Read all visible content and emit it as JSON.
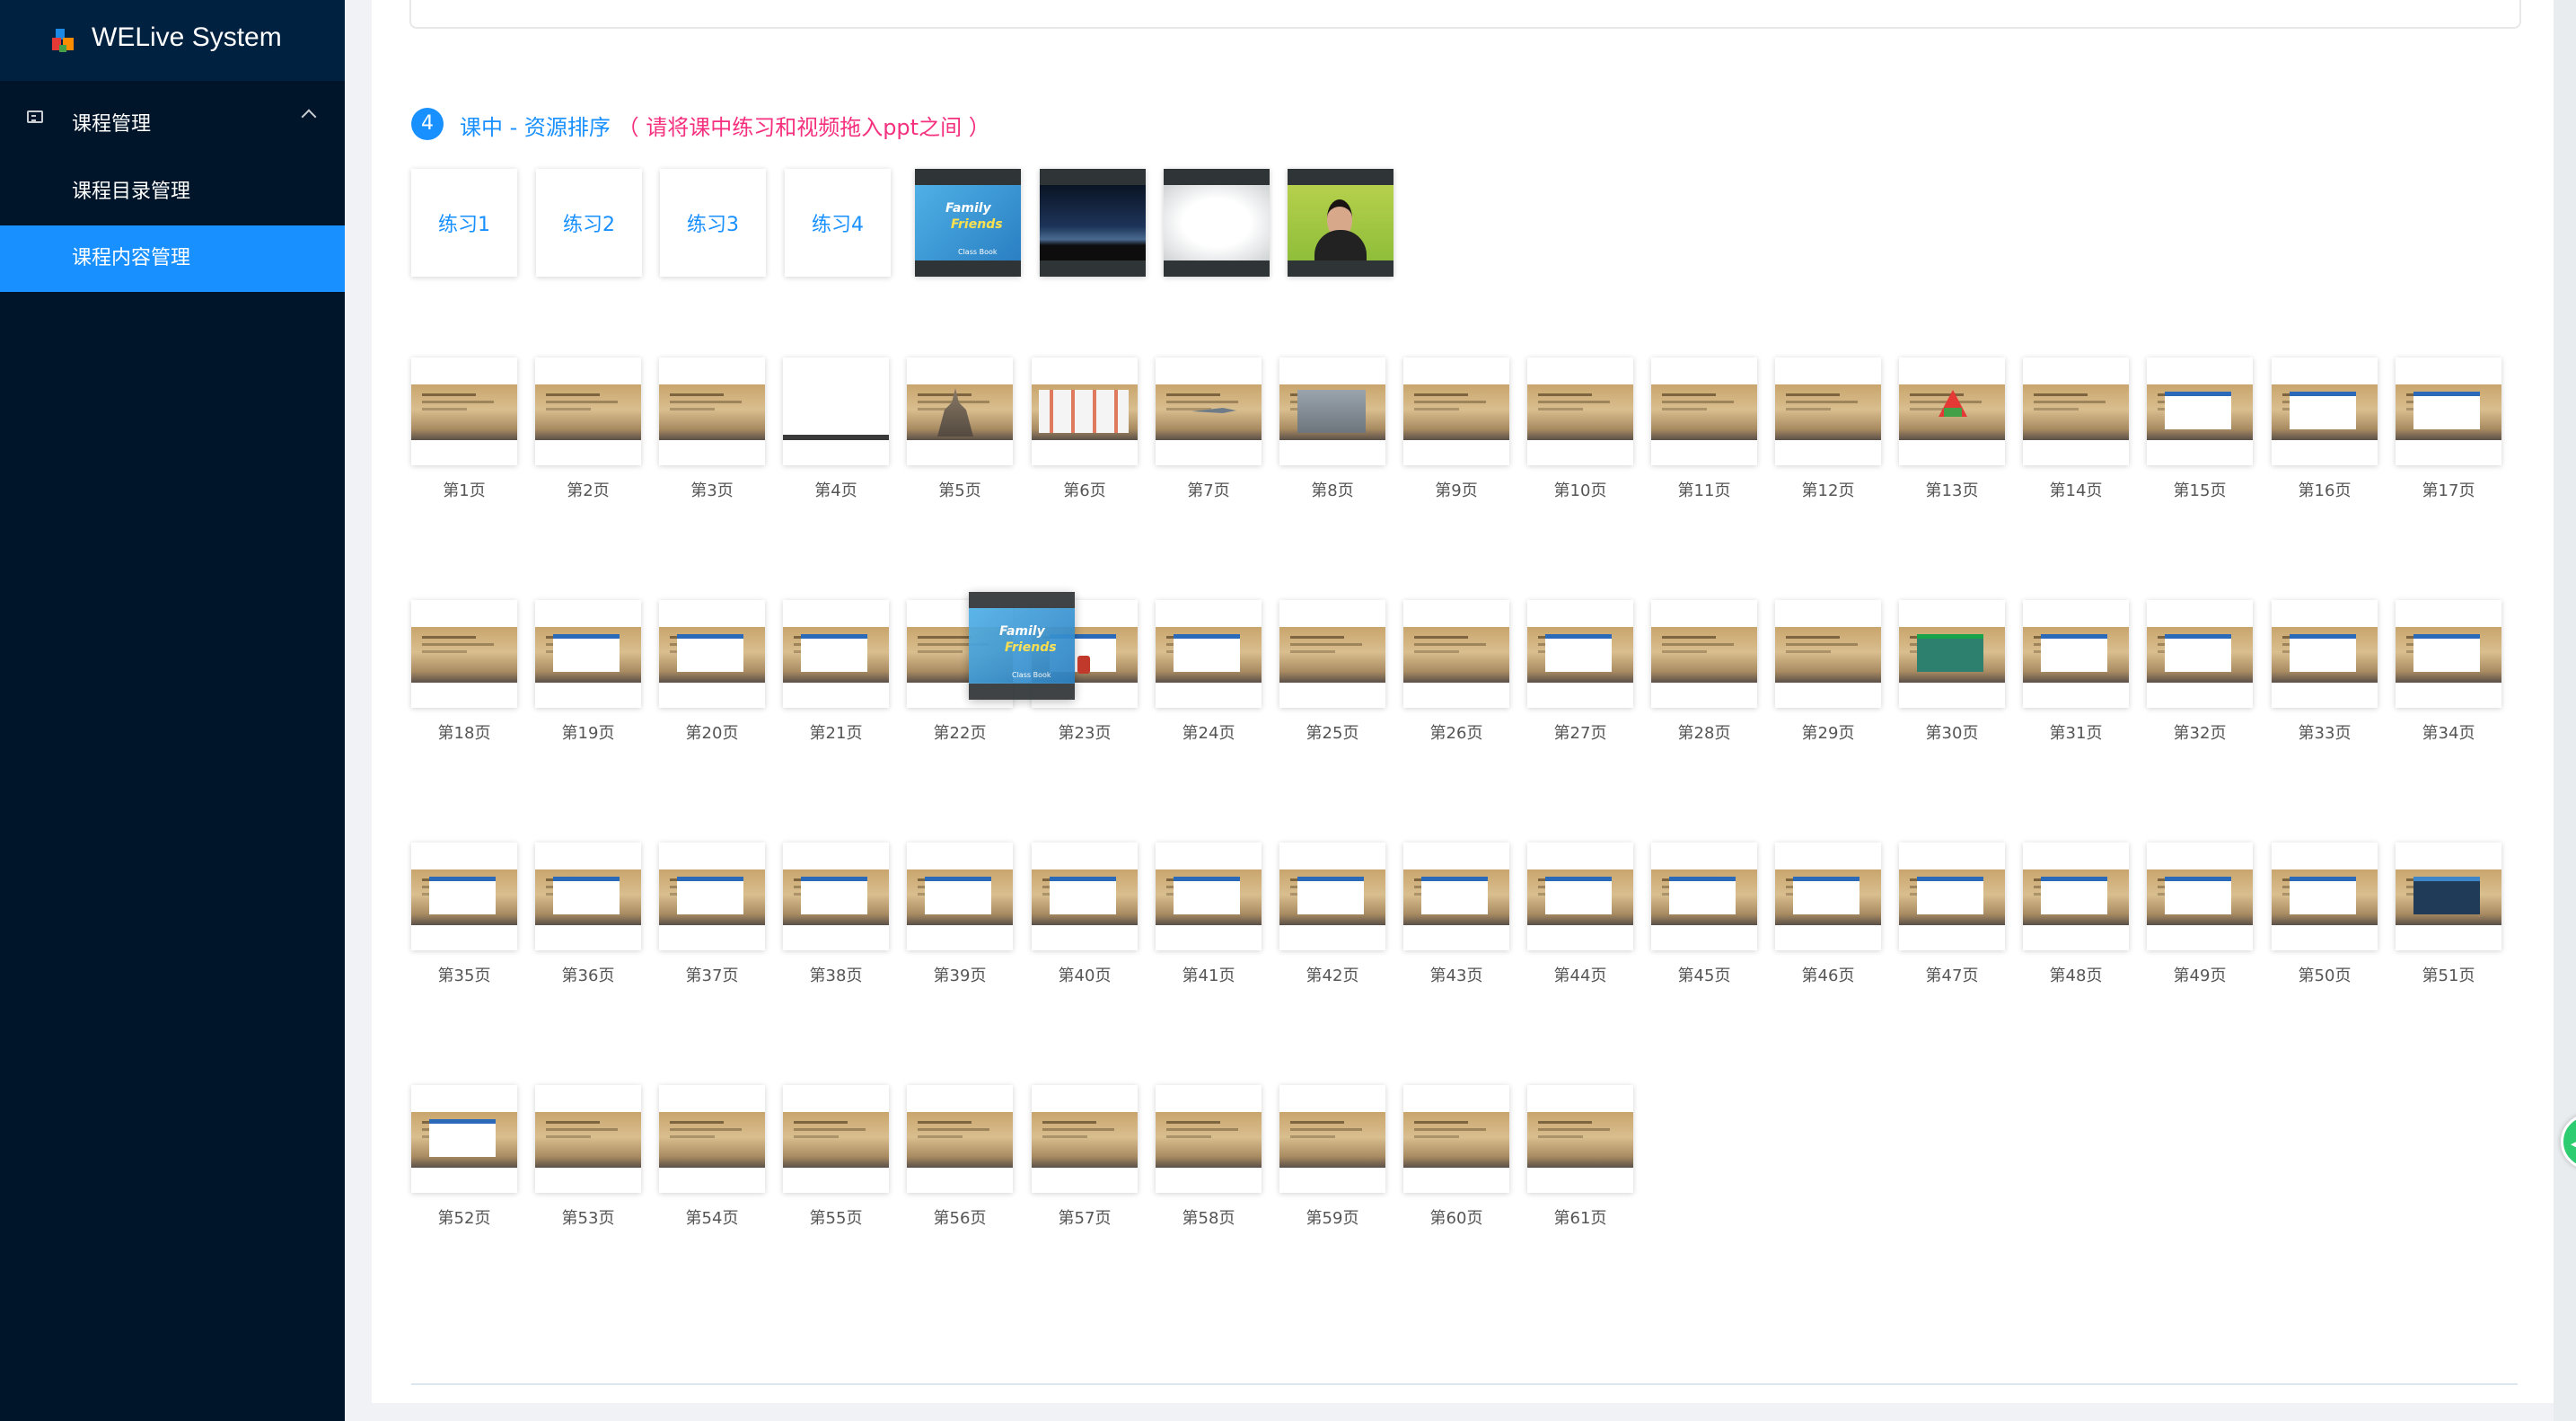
{
  "app": {
    "title": "WELive System"
  },
  "sidebar": {
    "group_label": "课程管理",
    "items": [
      {
        "label": "课程目录管理",
        "active": false
      },
      {
        "label": "课程内容管理",
        "active": true
      }
    ]
  },
  "section": {
    "step_number": "4",
    "title": "课中 - 资源排序",
    "hint": "（ 请将课中练习和视频拖入ppt之间 ）"
  },
  "exercises": [
    "练习1",
    "练习2",
    "练习3",
    "练习4"
  ],
  "media": [
    {
      "name": "Family and Friends cover",
      "title_line1": "Family",
      "title_line2": "Friends",
      "footer": "Class Book"
    },
    {
      "name": "night sky video"
    },
    {
      "name": "blank white video"
    },
    {
      "name": "teacher video"
    }
  ],
  "slides": [
    "第1页",
    "第2页",
    "第3页",
    "第4页",
    "第5页",
    "第6页",
    "第7页",
    "第8页",
    "第9页",
    "第10页",
    "第11页",
    "第12页",
    "第13页",
    "第14页",
    "第15页",
    "第16页",
    "第17页",
    "第18页",
    "第19页",
    "第20页",
    "第21页",
    "第22页",
    "第23页",
    "第24页",
    "第25页",
    "第26页",
    "第27页",
    "第28页",
    "第29页",
    "第30页",
    "第31页",
    "第32页",
    "第33页",
    "第34页",
    "第35页",
    "第36页",
    "第37页",
    "第38页",
    "第39页",
    "第40页",
    "第41页",
    "第42页",
    "第43页",
    "第44页",
    "第45页",
    "第46页",
    "第47页",
    "第48页",
    "第49页",
    "第50页",
    "第51页",
    "第52页",
    "第53页",
    "第54页",
    "第55页",
    "第56页",
    "第57页",
    "第58页",
    "第59页",
    "第60页",
    "第61页"
  ],
  "colors": {
    "sidebar_bg": "#001529",
    "accent": "#1890ff",
    "hint": "#f5317f"
  }
}
